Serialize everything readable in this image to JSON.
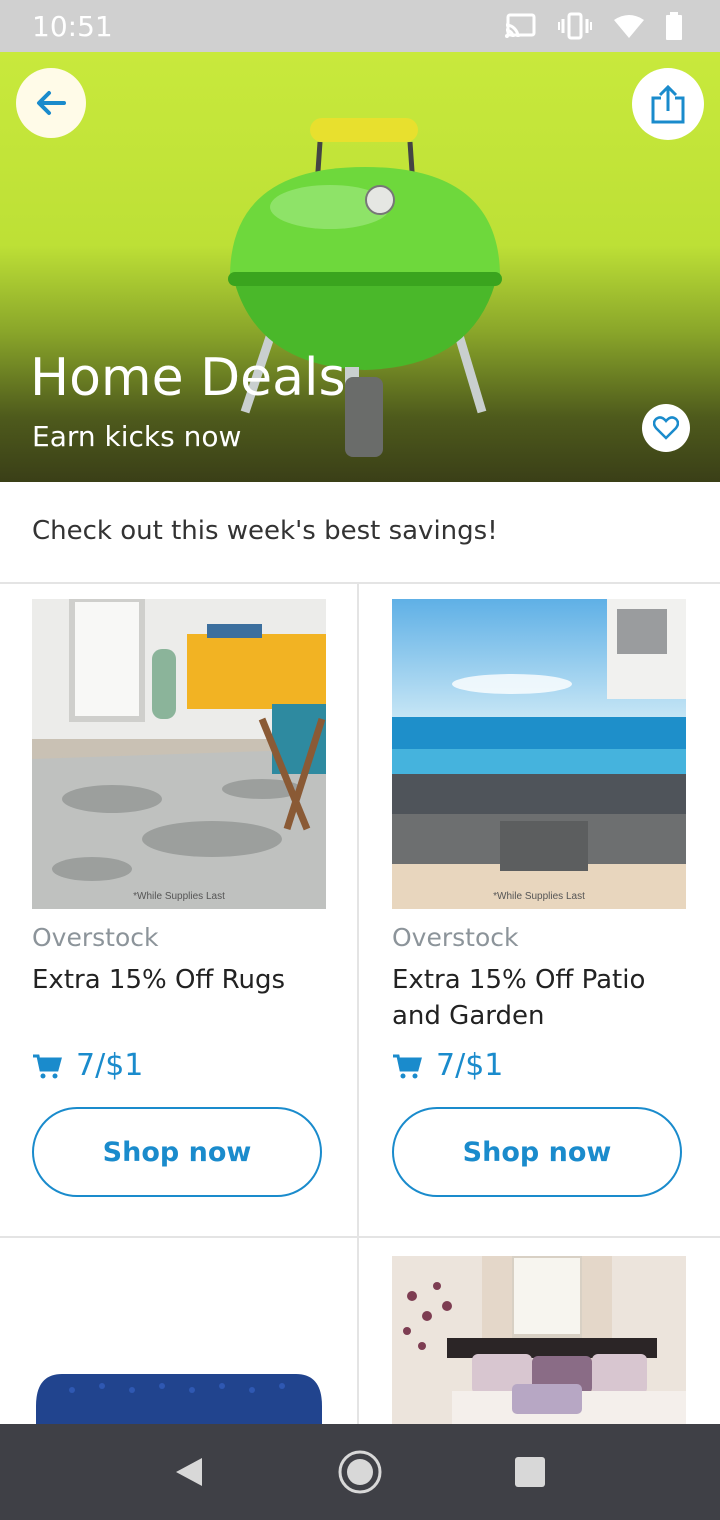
{
  "status_bar": {
    "time": "10:51"
  },
  "hero": {
    "title": "Home Deals",
    "subtitle": "Earn kicks now"
  },
  "intro": {
    "text": "Check out this week's best savings!"
  },
  "deals": [
    {
      "merchant": "Overstock",
      "name": "Extra 15% Off Rugs",
      "price": "7/$1",
      "button": "Shop now",
      "image_caption": "*While Supplies Last"
    },
    {
      "merchant": "Overstock",
      "name": "Extra 15% Off Patio and Garden",
      "price": "7/$1",
      "button": "Shop now",
      "image_caption": "*While Supplies Last"
    }
  ],
  "colors": {
    "accent": "#1a8bcc",
    "hero_bg": "#c8e93c",
    "navbar": "#3f4046"
  }
}
